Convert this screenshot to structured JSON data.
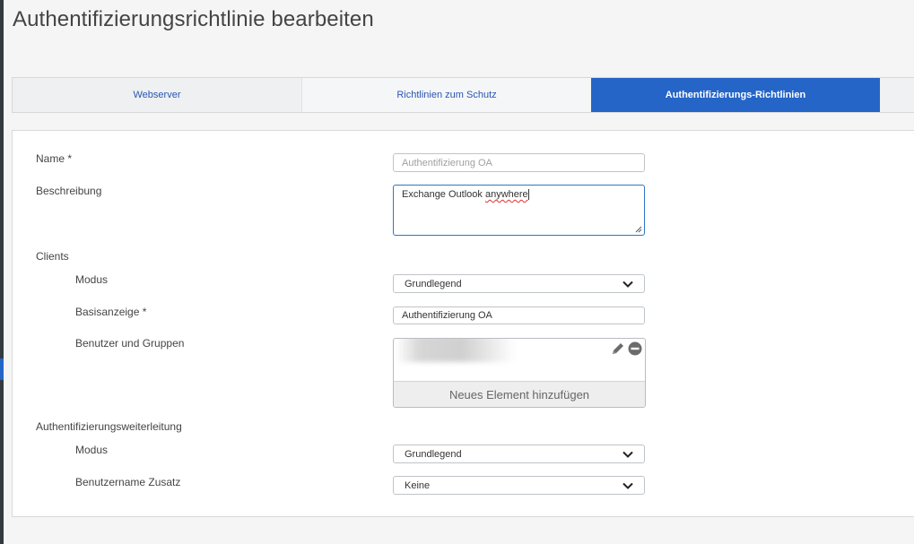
{
  "page": {
    "title": "Authentifizierungsrichtlinie bearbeiten"
  },
  "tabs": [
    {
      "label": "Webserver"
    },
    {
      "label": "Richtlinien zum Schutz"
    },
    {
      "label": "Authentifizierungs-Richtlinien"
    }
  ],
  "form": {
    "name": {
      "label": "Name *",
      "placeholder": "Authentifizierung OA"
    },
    "description": {
      "label": "Beschreibung",
      "value_plain": "Exchange Outlook ",
      "value_flagged": "anywhere"
    },
    "clients": {
      "section_label": "Clients",
      "mode": {
        "label": "Modus",
        "value": "Grundlegend"
      },
      "basic_display": {
        "label": "Basisanzeige *",
        "value": "Authentifizierung OA"
      },
      "users_groups": {
        "label": "Benutzer und Gruppen",
        "add_label": "Neues Element hinzufügen"
      }
    },
    "forwarding": {
      "section_label": "Authentifizierungsweiterleitung",
      "mode": {
        "label": "Modus",
        "value": "Grundlegend"
      },
      "username_suffix": {
        "label": "Benutzername Zusatz",
        "value": "Keine"
      }
    }
  },
  "icons": {
    "edit": "pencil-icon",
    "remove": "minus-circle-icon",
    "dropdown": "chevron-down-icon"
  },
  "colors": {
    "accent": "#2565c7",
    "focus_border": "#2e76c7"
  }
}
